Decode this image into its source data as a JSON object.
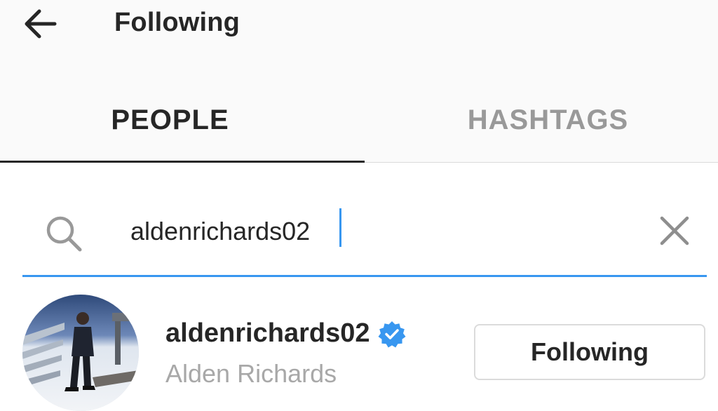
{
  "header": {
    "title": "Following",
    "back_icon": "arrow-left-icon"
  },
  "tabs": [
    {
      "label": "PEOPLE",
      "active": true
    },
    {
      "label": "HASHTAGS",
      "active": false
    }
  ],
  "search": {
    "value": "aldenrichards02",
    "icon": "search-icon",
    "clear_icon": "close-icon",
    "accent_color": "#3897f0"
  },
  "results": [
    {
      "username": "aldenrichards02",
      "full_name": "Alden Richards",
      "verified": true,
      "verified_icon": "verified-badge-icon",
      "button_label": "Following",
      "avatar_icon": "profile-photo"
    }
  ]
}
